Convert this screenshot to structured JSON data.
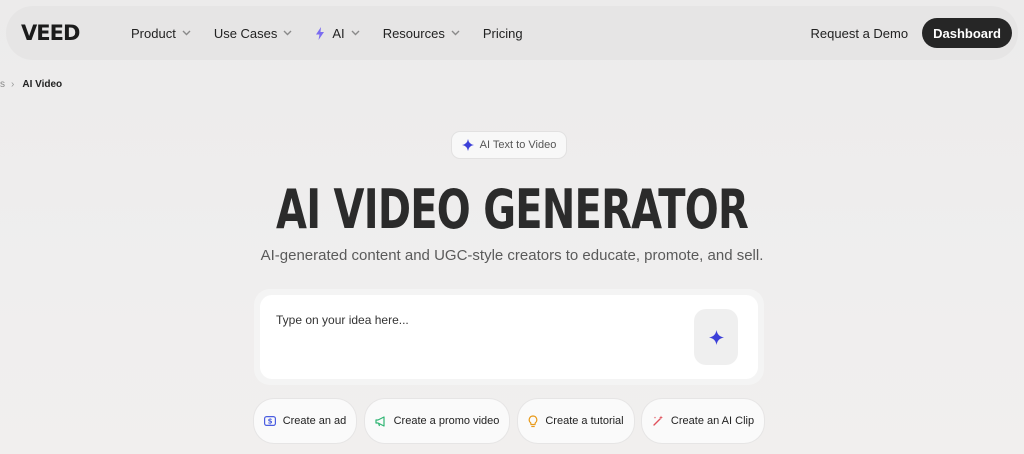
{
  "nav": {
    "logo_text": "VEED",
    "items": [
      {
        "label": "Product",
        "has_dropdown": true
      },
      {
        "label": "Use Cases",
        "has_dropdown": true
      },
      {
        "label": "AI",
        "has_dropdown": true,
        "icon": "lightning-icon"
      },
      {
        "label": "Resources",
        "has_dropdown": true
      },
      {
        "label": "Pricing",
        "has_dropdown": false
      }
    ],
    "request_demo": "Request a Demo",
    "dashboard": "Dashboard"
  },
  "breadcrumb": {
    "parent": "s",
    "separator": "›",
    "current": "AI Video"
  },
  "badge": {
    "label": "AI Text to Video",
    "icon": "sparkle-icon"
  },
  "hero": {
    "title": "AI VIDEO GENERATOR",
    "subtitle": "AI-generated content and UGC-style creators to educate, promote, and sell."
  },
  "prompt": {
    "placeholder": "Type on your idea here...",
    "value": "",
    "submit_icon": "sparkle-icon"
  },
  "chips": [
    {
      "label": "Create an ad",
      "icon": "dollar-icon"
    },
    {
      "label": "Create a promo video",
      "icon": "megaphone-icon"
    },
    {
      "label": "Create a tutorial",
      "icon": "lightbulb-icon"
    },
    {
      "label": "Create an AI Clip",
      "icon": "magic-wand-icon"
    }
  ],
  "colors": {
    "accent": "#3b3fd8",
    "dark_button": "#262626",
    "ad_icon": "#4a5de0",
    "promo_icon": "#2fb573",
    "tutorial_icon": "#e89a1a",
    "clip_icon": "#e0505a"
  }
}
